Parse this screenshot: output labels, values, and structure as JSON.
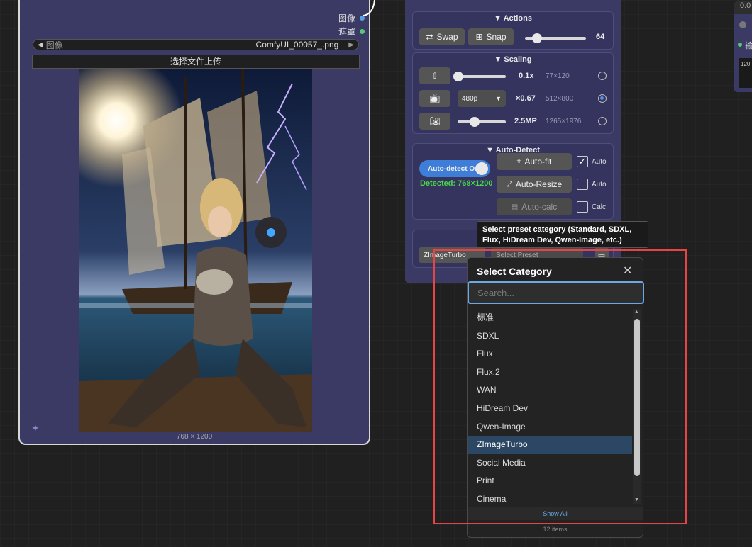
{
  "image_node": {
    "outputs": [
      {
        "label": "图像",
        "color": "#5aa0e0"
      },
      {
        "label": "遮罩",
        "color": "#58c878"
      }
    ],
    "combo_label": "图像",
    "combo_value": "ComfyUI_00057_.png",
    "upload_label": "选择文件上传",
    "image_size": "768 × 1200"
  },
  "actions": {
    "title": "▼ Actions",
    "swap_label": "Swap",
    "snap_label": "Snap",
    "slider_value": "64",
    "slider_level": 0.2
  },
  "scaling": {
    "title": "▼ Scaling",
    "rows": [
      {
        "icon": "upscale-icon",
        "value": "0.1x",
        "sub": "77×120",
        "selected": false,
        "slider_level": 0.02
      },
      {
        "icon": "tv-icon",
        "dropdown": "480p",
        "value": "×0.67",
        "sub": "512×800",
        "selected": true
      },
      {
        "icon": "camera-icon",
        "value": "2.5MP",
        "sub": "1265×1976",
        "selected": false,
        "slider_level": 0.35
      }
    ]
  },
  "auto_detect": {
    "title": "▼ Auto-Detect",
    "toggle_label": "Auto-detect On",
    "detected": "Detected: 768×1200",
    "autofit_label": "Auto-fit",
    "autoresize_label": "Auto-Resize",
    "autocalc_label": "Auto-calc",
    "check_auto_1": "Auto",
    "check_auto_2": "Auto",
    "check_calc": "Calc"
  },
  "preset_row": {
    "category": "ZImageTurbo",
    "preset": "Select Preset"
  },
  "right_node": {
    "top_label": "0.0",
    "field": "120",
    "output_label": "输"
  },
  "tooltip": "Select preset category (Standard, SDXL, Flux, HiDream Dev, Qwen-Image, etc.)",
  "dialog": {
    "title": "Select Category",
    "search_placeholder": "Search...",
    "items": [
      "标准",
      "SDXL",
      "Flux",
      "Flux.2",
      "WAN",
      "HiDream Dev",
      "Qwen-Image",
      "ZImageTurbo",
      "Social Media",
      "Print",
      "Cinema"
    ],
    "selected_index": 7,
    "show_all": "Show All",
    "count": "12 items"
  },
  "colors": {
    "node_bg": "#3a3a65",
    "accent_blue": "#3f7ed8",
    "detected_green": "#48d848",
    "highlight_red": "#e64545"
  }
}
